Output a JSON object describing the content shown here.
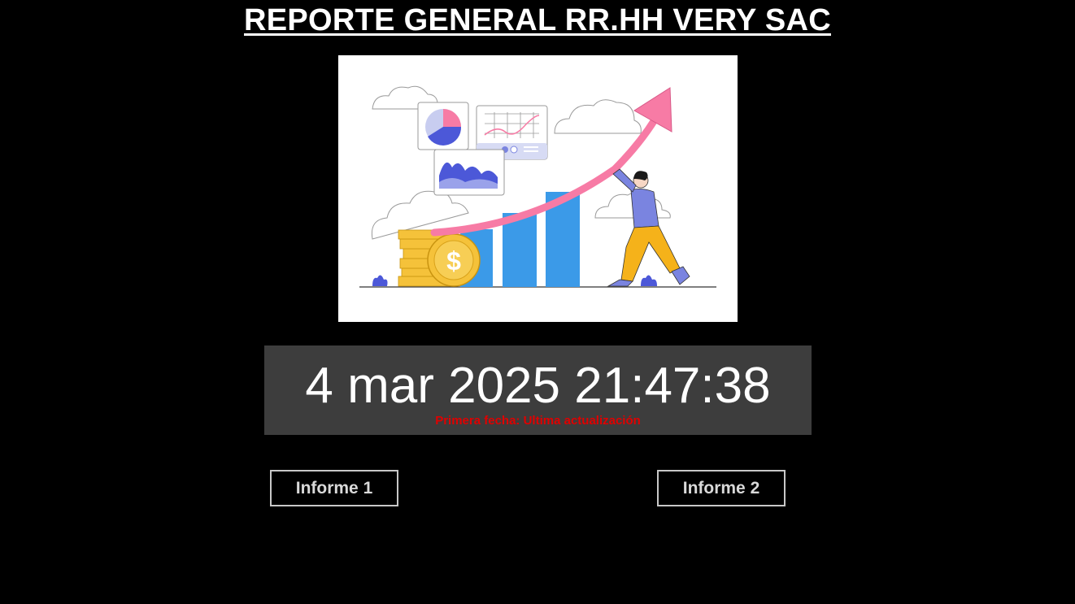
{
  "header": {
    "title": "REPORTE GENERAL RR.HH VERY SAC"
  },
  "clock": {
    "datetime": "4 mar 2025 21:47:38",
    "note": "Primera fecha: Ultima actualización"
  },
  "buttons": {
    "report1_label": "Informe 1",
    "report2_label": "Informe 2"
  },
  "colors": {
    "background": "#000000",
    "panel": "#3d3d3d",
    "note_red": "#e00000",
    "bar_blue": "#3b9ae8",
    "arrow_pink": "#f77ba5",
    "coin_gold": "#f5c23a"
  },
  "illustration": {
    "icon": "business-growth-illustration"
  }
}
